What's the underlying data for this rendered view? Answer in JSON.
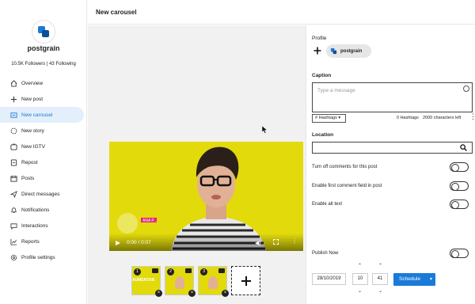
{
  "brand": {
    "name": "postgrain",
    "stats": "10.5K Followers | 43 Following"
  },
  "sidebar": {
    "items": [
      {
        "label": "Overview",
        "icon": "home-icon"
      },
      {
        "label": "New post",
        "icon": "plus-icon"
      },
      {
        "label": "New carousel",
        "icon": "carousel-icon"
      },
      {
        "label": "New story",
        "icon": "story-icon"
      },
      {
        "label": "New IGTV",
        "icon": "igtv-icon"
      },
      {
        "label": "Repost",
        "icon": "repost-icon"
      },
      {
        "label": "Posts",
        "icon": "calendar-icon"
      },
      {
        "label": "Direct messages",
        "icon": "send-icon"
      },
      {
        "label": "Notifications",
        "icon": "bell-icon"
      },
      {
        "label": "Interactions",
        "icon": "chat-icon"
      },
      {
        "label": "Reports",
        "icon": "chart-icon"
      },
      {
        "label": "Profile settings",
        "icon": "gear-icon"
      }
    ]
  },
  "header": {
    "title": "New carousel"
  },
  "player": {
    "time": "0:00 / 0:07",
    "overlay_text": "ANA P..."
  },
  "thumbs": [
    {
      "num": "1",
      "caption": "AUMENTAR"
    },
    {
      "num": "2",
      "caption": ""
    },
    {
      "num": "3",
      "caption": ""
    }
  ],
  "panel": {
    "profile_label": "Profile",
    "profile_chip": "postgrain",
    "caption_label": "Caption",
    "caption_placeholder": "Type a message",
    "hashtags_label": "Hashtags",
    "hashtag_count": "0 Hashtags",
    "chars_left": "2000 characters left",
    "location_label": "Location",
    "options": [
      "Turn off comments for this post",
      "Enable first comment field in post",
      "Enable alt text"
    ],
    "publish_now": "Publish Now",
    "date": "28/10/2019",
    "hour": "10",
    "minute": "41",
    "schedule_label": "Schedule"
  },
  "colors": {
    "accent": "#1a7ad9",
    "video_bg": "#e2da0b",
    "active_bg": "#e3effa"
  }
}
